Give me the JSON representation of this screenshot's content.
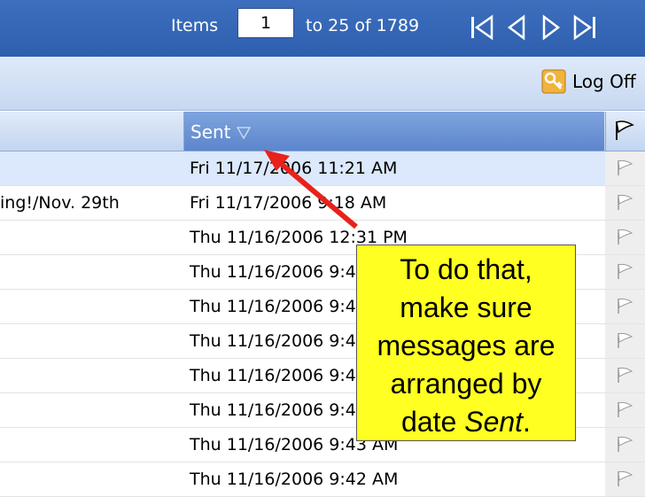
{
  "pager": {
    "items_label": "Items",
    "current_item": "1",
    "range_label": "to 25 of 1789",
    "nav_icons": [
      "first-page-icon",
      "previous-page-icon",
      "next-page-icon",
      "last-page-icon"
    ]
  },
  "toolbar": {
    "logoff_label": "Log Off",
    "logoff_icon": "key-icon"
  },
  "columns": {
    "sent_label": "Sent",
    "sort_icon": "sort-descending-icon",
    "flag_icon": "flag-icon"
  },
  "messages": [
    {
      "subject": "",
      "date": "Fri 11/17/2006 11:21 AM",
      "selected": true
    },
    {
      "subject": "ing!/Nov. 29th",
      "date": "Fri 11/17/2006 9:18 AM"
    },
    {
      "subject": "",
      "date": "Thu 11/16/2006 12:31 PM"
    },
    {
      "subject": "",
      "date": "Thu 11/16/2006 9:45 AM"
    },
    {
      "subject": "",
      "date": "Thu 11/16/2006 9:45 AM"
    },
    {
      "subject": "",
      "date": "Thu 11/16/2006 9:44 AM"
    },
    {
      "subject": "",
      "date": "Thu 11/16/2006 9:44 AM"
    },
    {
      "subject": "",
      "date": "Thu 11/16/2006 9:44 AM"
    },
    {
      "subject": "",
      "date": "Thu 11/16/2006 9:43 AM"
    },
    {
      "subject": "",
      "date": "Thu 11/16/2006 9:42 AM"
    }
  ],
  "callout": {
    "line1": "To do that,",
    "line2": "make sure",
    "line3": "messages are",
    "line4": "arranged by",
    "line5_prefix": "date ",
    "line5_emphasis": "Sent",
    "line5_suffix": ".",
    "background_color": "#ffff22",
    "arrow_color": "#e8221a"
  }
}
